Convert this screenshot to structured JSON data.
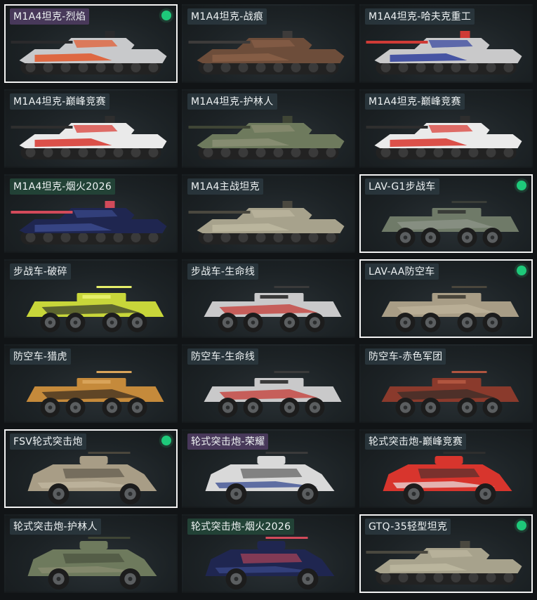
{
  "items": [
    {
      "name": "M1A4坦克-烈焰",
      "type": "tank",
      "selected": true,
      "owned": true,
      "label_style": "purple",
      "colors": [
        "#c8c9cb",
        "#e2572a",
        "#2a2a2c"
      ]
    },
    {
      "name": "M1A4坦克-战痕",
      "type": "tank",
      "selected": false,
      "owned": false,
      "label_style": "",
      "colors": [
        "#6d4d3a",
        "#8a6048",
        "#3d3b3a"
      ]
    },
    {
      "name": "M1A4坦克-哈夫克重工",
      "type": "tank",
      "selected": false,
      "owned": false,
      "label_style": "",
      "colors": [
        "#c9c9ca",
        "#2f3f9c",
        "#cf3b36"
      ]
    },
    {
      "name": "M1A4坦克-巅峰竞赛",
      "type": "tank",
      "selected": false,
      "owned": false,
      "label_style": "",
      "colors": [
        "#eaeaea",
        "#d8352d",
        "#2e2e2e"
      ]
    },
    {
      "name": "M1A4坦克-护林人",
      "type": "tank",
      "selected": false,
      "owned": false,
      "label_style": "",
      "colors": [
        "#6e7a5d",
        "#8b8f74",
        "#3f4535"
      ]
    },
    {
      "name": "M1A4坦克-巅峰竞赛",
      "type": "tank",
      "selected": false,
      "owned": false,
      "label_style": "",
      "colors": [
        "#eaeaea",
        "#d8352d",
        "#2e2e2e"
      ]
    },
    {
      "name": "M1A4坦克-烟火2026",
      "type": "tank",
      "selected": false,
      "owned": false,
      "label_style": "green",
      "colors": [
        "#1f2650",
        "#3b4a8c",
        "#d24a5a"
      ]
    },
    {
      "name": "M1A4主战坦克",
      "type": "tank",
      "selected": false,
      "owned": false,
      "label_style": "",
      "colors": [
        "#a7a28c",
        "#bdb8a0",
        "#4a483f"
      ]
    },
    {
      "name": "LAV-G1步战车",
      "type": "wheeled8",
      "selected": true,
      "owned": true,
      "label_style": "",
      "colors": [
        "#6f7a68",
        "#8d968a",
        "#3a3d38"
      ]
    },
    {
      "name": "步战车-破碎",
      "type": "wheeled8",
      "selected": false,
      "owned": false,
      "label_style": "",
      "colors": [
        "#c8d63a",
        "#3a3f2c",
        "#e6ef6a"
      ]
    },
    {
      "name": "步战车-生命线",
      "type": "wheeled8",
      "selected": false,
      "owned": false,
      "label_style": "",
      "colors": [
        "#c9c9ca",
        "#c43a34",
        "#3a3a3a"
      ]
    },
    {
      "name": "LAV-AA防空车",
      "type": "wheeled8",
      "selected": true,
      "owned": true,
      "label_style": "",
      "colors": [
        "#a89d86",
        "#bfb49b",
        "#4a463c"
      ]
    },
    {
      "name": "防空车-猎虎",
      "type": "wheeled8",
      "selected": false,
      "owned": false,
      "label_style": "",
      "colors": [
        "#c58a3b",
        "#3c2e20",
        "#d9a45a"
      ]
    },
    {
      "name": "防空车-生命线",
      "type": "wheeled8",
      "selected": false,
      "owned": false,
      "label_style": "",
      "colors": [
        "#c9c9ca",
        "#c43a34",
        "#3a3a3a"
      ]
    },
    {
      "name": "防空车-赤色军团",
      "type": "wheeled8",
      "selected": false,
      "owned": false,
      "label_style": "",
      "colors": [
        "#8a3a2c",
        "#3a2d28",
        "#b0553f"
      ]
    },
    {
      "name": "FSV轮式突击炮",
      "type": "armored4",
      "selected": true,
      "owned": true,
      "label_style": "",
      "colors": [
        "#a89d86",
        "#c3b9a3",
        "#4a463c"
      ]
    },
    {
      "name": "轮式突击炮-荣耀",
      "type": "armored4",
      "selected": false,
      "owned": false,
      "label_style": "purple",
      "colors": [
        "#d9d9d9",
        "#2a3f8a",
        "#3a3a3a"
      ]
    },
    {
      "name": "轮式突击炮-巅峰竞赛",
      "type": "armored4",
      "selected": false,
      "owned": false,
      "label_style": "",
      "colors": [
        "#d8352d",
        "#eaeaea",
        "#2e2e2e"
      ]
    },
    {
      "name": "轮式突击炮-护林人",
      "type": "armored4",
      "selected": false,
      "owned": false,
      "label_style": "",
      "colors": [
        "#6e7a5d",
        "#8b8f74",
        "#3f4535"
      ]
    },
    {
      "name": "轮式突击炮-烟火2026",
      "type": "armored4",
      "selected": false,
      "owned": false,
      "label_style": "green",
      "colors": [
        "#1f2650",
        "#3b4a8c",
        "#d24a5a"
      ]
    },
    {
      "name": "GTQ-35轻型坦克",
      "type": "tank",
      "selected": true,
      "owned": true,
      "label_style": "",
      "colors": [
        "#a7a28c",
        "#bdb8a0",
        "#4a483f"
      ]
    }
  ]
}
